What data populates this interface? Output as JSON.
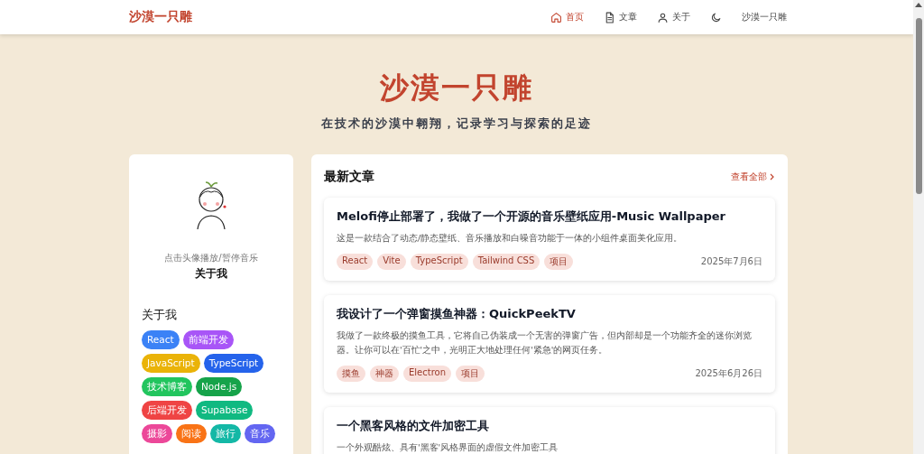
{
  "header": {
    "logo": "沙漠一只雕",
    "nav": [
      {
        "label": "首页",
        "selected": true
      },
      {
        "label": "文章",
        "selected": false
      },
      {
        "label": "关于",
        "selected": false
      }
    ],
    "user": "沙漠一只雕"
  },
  "hero": {
    "title": "沙漠一只雕",
    "subtitle": "在技术的沙漠中翱翔，记录学习与探索的足迹"
  },
  "profile": {
    "hint": "点击头像播放/暂停音乐",
    "name": "关于我",
    "heading": "关于我",
    "tags": [
      {
        "label": "React",
        "color": "#3b82f6"
      },
      {
        "label": "前端开发",
        "color": "#a855f7"
      },
      {
        "label": "JavaScript",
        "color": "#eab308"
      },
      {
        "label": "TypeScript",
        "color": "#2563eb"
      },
      {
        "label": "技术博客",
        "color": "#22c55e"
      },
      {
        "label": "Node.js",
        "color": "#16a34a"
      },
      {
        "label": "后端开发",
        "color": "#ef4444"
      },
      {
        "label": "Supabase",
        "color": "#10b981"
      },
      {
        "label": "摄影",
        "color": "#ec4899"
      },
      {
        "label": "阅读",
        "color": "#f97316"
      },
      {
        "label": "旅行",
        "color": "#14b8a6"
      },
      {
        "label": "音乐",
        "color": "#6366f1"
      }
    ]
  },
  "articles": {
    "heading": "最新文章",
    "view_all": "查看全部",
    "items": [
      {
        "title": "Melofi停止部署了，我做了一个开源的音乐壁纸应用-Music Wallpaper",
        "summary": "这是一款结合了动态/静态壁纸、音乐播放和白噪音功能于一体的小组件桌面美化应用。",
        "tags": [
          "React",
          "Vite",
          "TypeScript",
          "Tailwind CSS",
          "项目"
        ],
        "date": "2025年7月6日"
      },
      {
        "title": "我设计了一个弹窗摸鱼神器：QuickPeekTV",
        "summary": "我做了一款终极的摸鱼工具，它将自己伪装成一个无害的弹窗广告，但内部却是一个功能齐全的迷你浏览器。让你可以在'百忙'之中，光明正大地处理任何'紧急'的网页任务。",
        "tags": [
          "摸鱼",
          "神器",
          "Electron",
          "项目"
        ],
        "date": "2025年6月26日"
      },
      {
        "title": "一个黑客风格的文件加密工具",
        "summary": "一个外观酷炫、具有'黑客'风格界面的虚假文件加密工具"
      }
    ]
  }
}
